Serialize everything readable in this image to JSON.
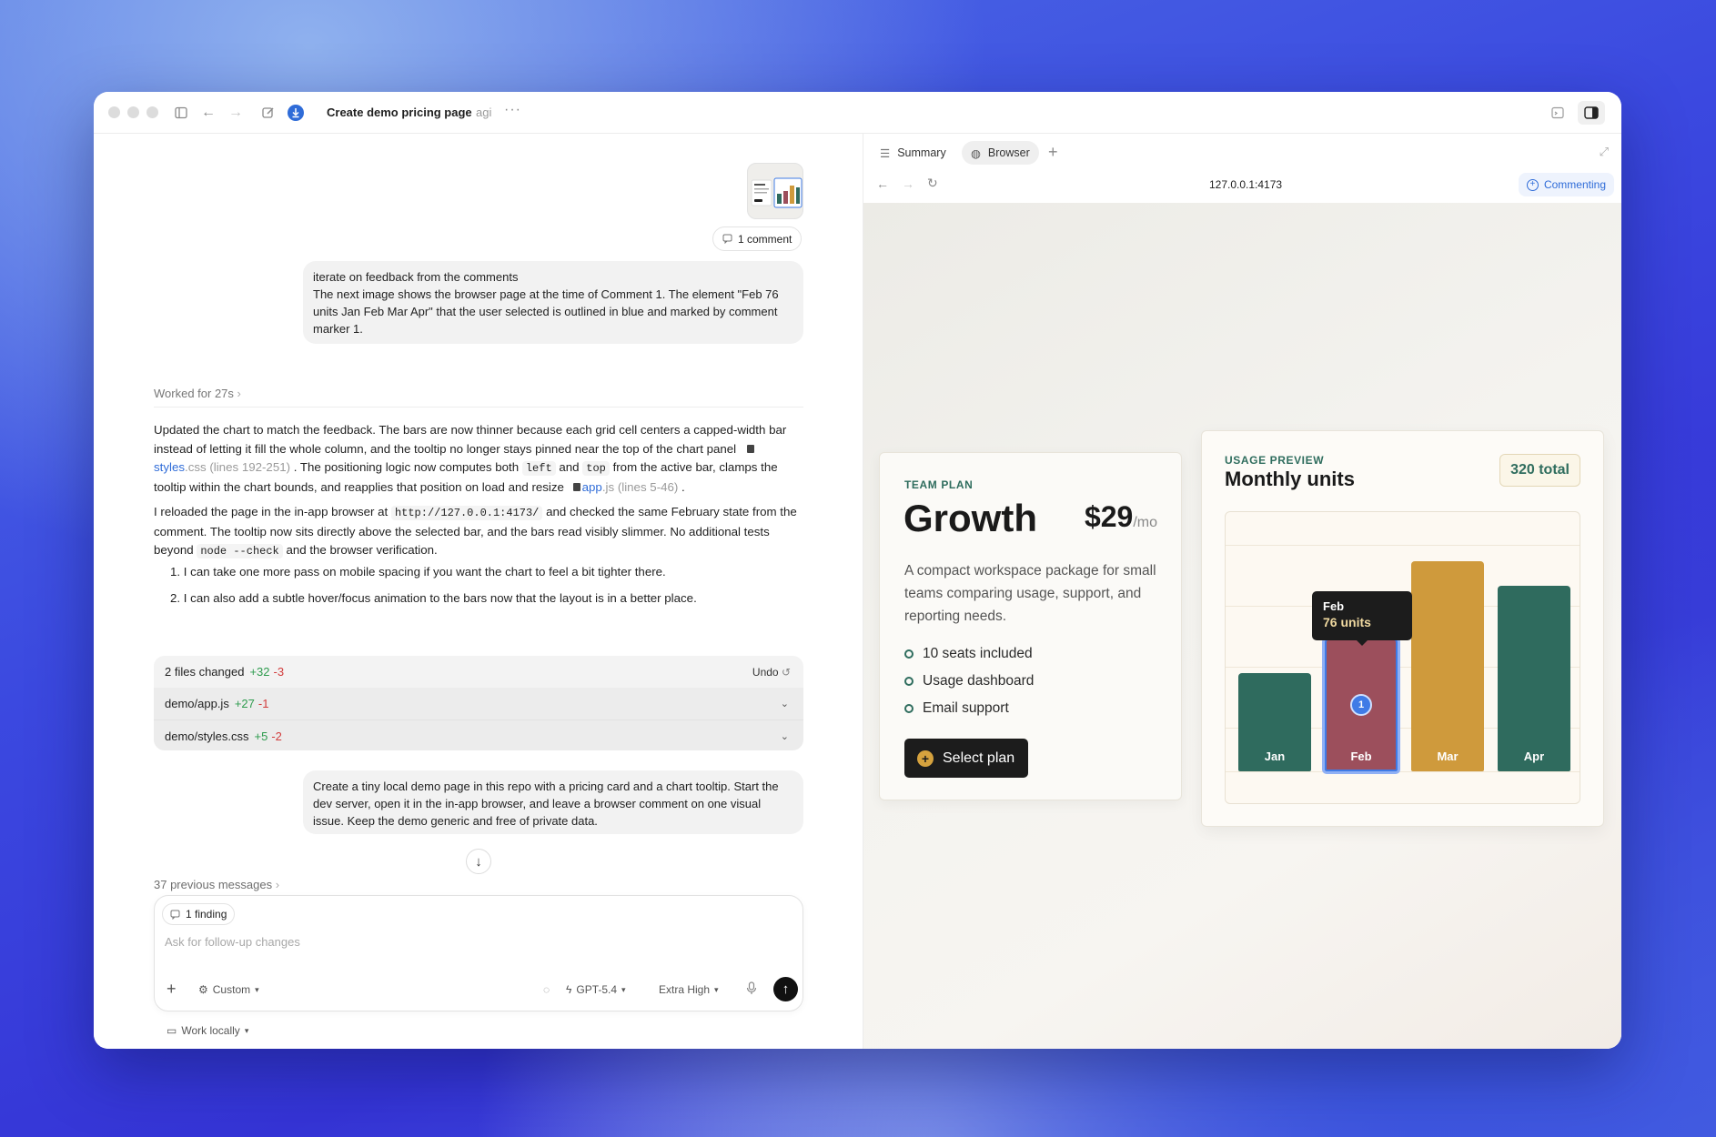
{
  "window": {
    "title": "Create demo pricing page",
    "project": "agi"
  },
  "chat": {
    "comment_chip": "1 comment",
    "user_message_1": {
      "line1": "iterate on feedback from the comments",
      "line2": "The next image shows the browser page at the time of Comment 1. The element \"Feb 76 units Jan Feb Mar Apr\" that the user selected is outlined in blue and marked by comment marker 1."
    },
    "worked_label": "Worked for 27s",
    "reply": {
      "p1_a": "Updated the chart to match the feedback. The bars are now thinner because each grid cell centers a capped-width bar instead of letting it fill the whole column, and the tooltip no longer stays pinned near the top of the chart panel",
      "p1_file1_name": "styles",
      "p1_file1_ext": ".css",
      "p1_file1_lines": "(lines 192-251)",
      "p1_b": ". The positioning logic now computes both",
      "p1_code1": "left",
      "p1_and": "and",
      "p1_code2": "top",
      "p1_c": "from the active bar, clamps the tooltip within the chart bounds, and reapplies that position on load and resize",
      "p1_file2_name": "app",
      "p1_file2_ext": ".js",
      "p1_file2_lines": "(lines 5-46)",
      "p1_end": ".",
      "p2_a": "I reloaded the page in the in-app browser at",
      "p2_code": "http://127.0.0.1:4173/",
      "p2_b": "and checked the same February state from the comment. The tooltip now sits directly above the selected bar, and the bars read visibly slimmer. No additional tests beyond",
      "p2_code2": "node --check",
      "p2_c": "and the browser verification.",
      "list": [
        "1. I can take one more pass on mobile spacing if you want the chart to feel a bit tighter there.",
        "2. I can also add a subtle hover/focus animation to the bars now that the layout is in a better place."
      ]
    },
    "changes": {
      "summary": "2 files changed",
      "add": "+32",
      "del": "-3",
      "undo": "Undo",
      "files": [
        {
          "name": "demo/app.js",
          "add": "+27",
          "del": "-1"
        },
        {
          "name": "demo/styles.css",
          "add": "+5",
          "del": "-2"
        }
      ]
    },
    "user_message_2": "Create a tiny local demo page in this repo with a pricing card and a chart tooltip. Start the dev server, open it in the in-app browser, and leave a browser comment on one visual issue. Keep the demo generic and free of private data.",
    "previous": "37 previous messages",
    "composer": {
      "finding_chip": "1 finding",
      "placeholder": "Ask for follow-up changes",
      "mode": "Custom",
      "model": "GPT-5.4",
      "effort": "Extra High"
    },
    "work_locally": "Work locally"
  },
  "browser": {
    "tabs": [
      "Summary",
      "Browser"
    ],
    "url": "127.0.0.1:4173",
    "commenting": "Commenting",
    "pricing": {
      "eyebrow": "TEAM PLAN",
      "name": "Growth",
      "price": "$29",
      "per": "/mo",
      "description": "A compact workspace package for small teams comparing usage, support, and reporting needs.",
      "features": [
        "10 seats included",
        "Usage dashboard",
        "Email support"
      ],
      "cta": "Select plan"
    },
    "usage": {
      "eyebrow": "USAGE PREVIEW",
      "title": "Monthly units",
      "total": "320 total",
      "tooltip_month": "Feb",
      "tooltip_value": "76 units",
      "marker": "1"
    }
  },
  "chart_data": {
    "type": "bar",
    "categories": [
      "Jan",
      "Feb",
      "Mar",
      "Apr"
    ],
    "values": [
      56,
      76,
      120,
      106
    ],
    "colors": [
      "#2f6b5e",
      "#9c4f5c",
      "#cf9a3c",
      "#2f6b5e"
    ],
    "selected": "Feb"
  },
  "colors": {
    "accent": "#2f6cd8",
    "brand_green": "#2f6d5e",
    "add": "#2e9b4e",
    "del": "#d23c3c"
  }
}
